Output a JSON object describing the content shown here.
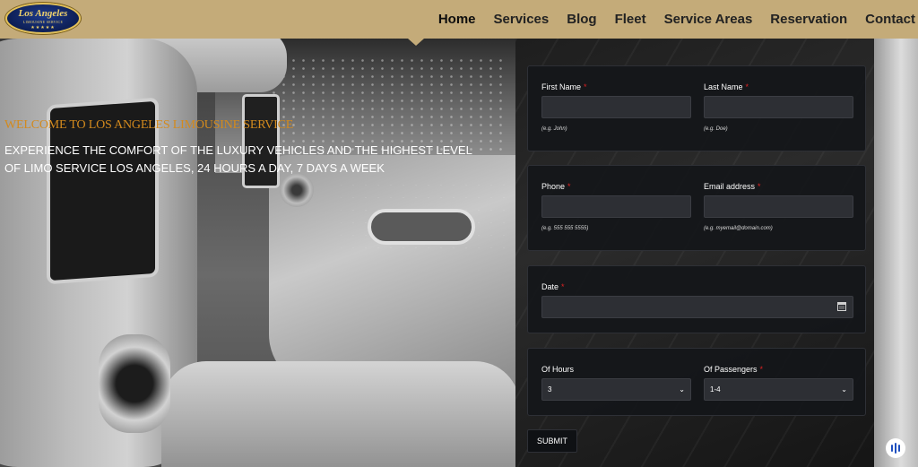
{
  "logo": {
    "title": "Los Angeles",
    "subtitle": "LIMOUSINE SERVICE",
    "stars": "★★★★★"
  },
  "nav": {
    "items": [
      {
        "label": "Home",
        "active": true
      },
      {
        "label": "Services"
      },
      {
        "label": "Blog"
      },
      {
        "label": "Fleet"
      },
      {
        "label": "Service Areas"
      },
      {
        "label": "Reservation"
      },
      {
        "label": "Contact"
      }
    ]
  },
  "hero": {
    "welcome": "WELCOME TO LOS ANGELES LIMOUSINE SERVICE",
    "tagline": "EXPERIENCE THE COMFORT OF THE LUXURY VEHICLES AND THE HIGHEST LEVEL OF LIMO SERVICE LOS ANGELES, 24 HOURS A DAY, 7 DAYS A WEEK"
  },
  "form": {
    "first_name": {
      "label": "First Name",
      "required": "*",
      "value": "",
      "hint": "(e.g. John)"
    },
    "last_name": {
      "label": "Last Name",
      "required": "*",
      "value": "",
      "hint": "(e.g. Doe)"
    },
    "phone": {
      "label": "Phone",
      "required": "*",
      "value": "",
      "hint": "(e.g. 555 555 5555)"
    },
    "email": {
      "label": "Email address",
      "required": "*",
      "value": "",
      "hint": "(e.g. myemail@domain.com)"
    },
    "date": {
      "label": "Date",
      "required": "*",
      "value": ""
    },
    "hours": {
      "label": "Of Hours",
      "value": "3"
    },
    "passengers": {
      "label": "Of Passengers",
      "required": "*",
      "value": "1-4"
    },
    "submit_label": "SUBMIT"
  },
  "colors": {
    "header": "#c4ab79",
    "welcome": "#d38a1d",
    "required": "#dd2222",
    "panel": "#14161a"
  }
}
